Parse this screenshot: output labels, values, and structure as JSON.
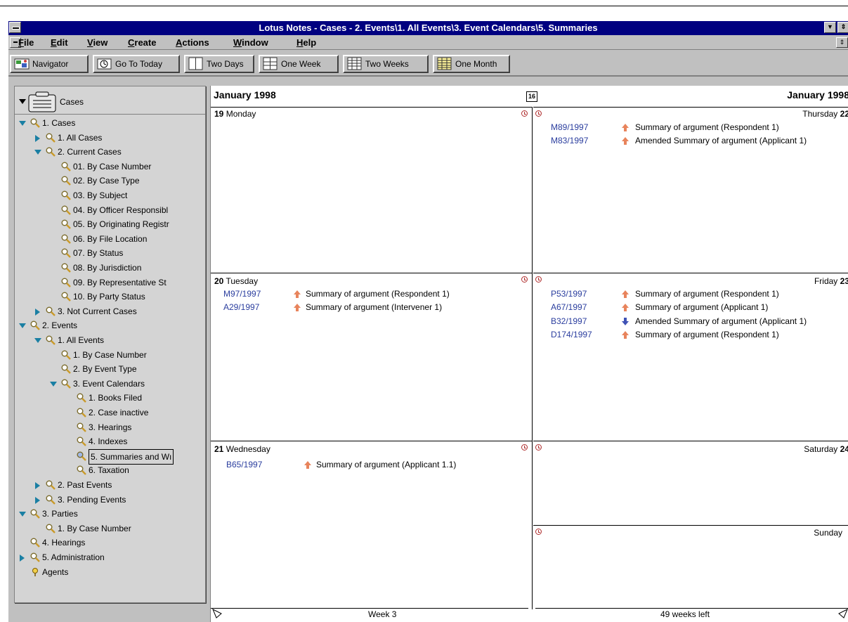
{
  "window": {
    "title": "Lotus Notes - Cases - 2. Events\\1. All Events\\3. Event Calendars\\5. Summaries"
  },
  "menu": [
    {
      "label": "File",
      "u": "F",
      "rest": "ile"
    },
    {
      "label": "Edit",
      "u": "E",
      "rest": "dit"
    },
    {
      "label": "View",
      "u": "V",
      "rest": "iew"
    },
    {
      "label": "Create",
      "u": "C",
      "rest": "reate"
    },
    {
      "label": "Actions",
      "u": "A",
      "rest": "ctions"
    },
    {
      "label": "Window",
      "u": "W",
      "rest": "indow"
    },
    {
      "label": "Help",
      "u": "H",
      "rest": "elp"
    }
  ],
  "toolbar": {
    "navigator": "Navigator",
    "go_to_today": "Go To Today",
    "two_days": "Two Days",
    "one_week": "One Week",
    "two_weeks": "Two Weeks",
    "one_month": "One Month"
  },
  "navigator": {
    "root": "Cases",
    "items": [
      {
        "label": "1. Cases",
        "twistie": "down",
        "level": 0
      },
      {
        "label": "1. All Cases",
        "twistie": "right",
        "level": 1
      },
      {
        "label": "2. Current Cases",
        "twistie": "down",
        "level": 1
      },
      {
        "label": "01. By Case Number",
        "twistie": "",
        "level": 2
      },
      {
        "label": "02. By Case Type",
        "twistie": "",
        "level": 2
      },
      {
        "label": "03. By Subject",
        "twistie": "",
        "level": 2
      },
      {
        "label": "04. By Officer Responsibl",
        "twistie": "",
        "level": 2
      },
      {
        "label": "05. By Originating Registr",
        "twistie": "",
        "level": 2
      },
      {
        "label": "06. By File Location",
        "twistie": "",
        "level": 2
      },
      {
        "label": "07. By Status",
        "twistie": "",
        "level": 2
      },
      {
        "label": "08. By Jurisdiction",
        "twistie": "",
        "level": 2
      },
      {
        "label": "09. By Representative St",
        "twistie": "",
        "level": 2
      },
      {
        "label": "10. By Party Status",
        "twistie": "",
        "level": 2
      },
      {
        "label": "3. Not Current Cases",
        "twistie": "right",
        "level": 1
      },
      {
        "label": "2. Events",
        "twistie": "down",
        "level": 0
      },
      {
        "label": "1. All Events",
        "twistie": "down",
        "level": 1
      },
      {
        "label": "1. By Case Number",
        "twistie": "",
        "level": 2
      },
      {
        "label": "2. By Event Type",
        "twistie": "",
        "level": 2
      },
      {
        "label": "3. Event Calendars",
        "twistie": "down",
        "level": 2
      },
      {
        "label": "1. Books Filed",
        "twistie": "",
        "level": 3
      },
      {
        "label": "2. Case inactive",
        "twistie": "",
        "level": 3
      },
      {
        "label": "3. Hearings",
        "twistie": "",
        "level": 3
      },
      {
        "label": "4. Indexes",
        "twistie": "",
        "level": 3
      },
      {
        "label": "5. Summaries and Wı",
        "twistie": "",
        "level": 3,
        "selected": true
      },
      {
        "label": "6. Taxation",
        "twistie": "",
        "level": 3
      },
      {
        "label": "2. Past Events",
        "twistie": "right",
        "level": 1
      },
      {
        "label": "3. Pending Events",
        "twistie": "right",
        "level": 1
      },
      {
        "label": "3. Parties",
        "twistie": "down",
        "level": 0
      },
      {
        "label": "1. By Case Number",
        "twistie": "",
        "level": 1
      },
      {
        "label": "4. Hearings",
        "twistie": "",
        "level": 0
      },
      {
        "label": "5. Administration",
        "twistie": "right",
        "level": 0
      },
      {
        "label": "Agents",
        "twistie": "",
        "level": 0,
        "icon": "agent"
      }
    ]
  },
  "calendar": {
    "month_left": "January 1998",
    "month_right": "January 1998",
    "today_icon": "16",
    "days": {
      "mon": {
        "num": "19",
        "name": "Monday"
      },
      "tue": {
        "num": "20",
        "name": "Tuesday"
      },
      "wed": {
        "num": "21",
        "name": "Wednesday"
      },
      "thu": {
        "name": "Thursday",
        "num": "22"
      },
      "fri": {
        "name": "Friday",
        "num": "23"
      },
      "sat": {
        "name": "Saturday",
        "num": "24"
      },
      "sun": {
        "name": "Sunday",
        "num": ""
      }
    },
    "events": {
      "tue": [
        {
          "case": "M97/1997",
          "arrow": "up",
          "desc": "Summary of argument (Respondent 1)"
        },
        {
          "case": "A29/1997",
          "arrow": "up",
          "desc": "Summary of argument (Intervener 1)"
        }
      ],
      "wed": [
        {
          "case": "B65/1997",
          "arrow": "up",
          "desc": "Summary of argument (Applicant 1.1)"
        }
      ],
      "thu": [
        {
          "case": "M89/1997",
          "arrow": "up",
          "desc": "Summary of argument (Respondent 1)"
        },
        {
          "case": "M83/1997",
          "arrow": "up",
          "desc": "Amended Summary of argument (Applicant 1)"
        }
      ],
      "fri": [
        {
          "case": "P53/1997",
          "arrow": "up",
          "desc": "Summary of argument (Respondent 1)"
        },
        {
          "case": "A67/1997",
          "arrow": "up",
          "desc": "Summary of argument (Applicant 1)"
        },
        {
          "case": "B32/1997",
          "arrow": "down",
          "desc": "Amended Summary of argument (Applicant 1)"
        },
        {
          "case": "D174/1997",
          "arrow": "up",
          "desc": "Summary of argument (Respondent 1)"
        }
      ]
    },
    "footer_left": "Week 3",
    "footer_right": "49 weeks left"
  },
  "colors": {
    "titlebar": "#000080",
    "case_link": "#2a3d9e",
    "arrow_up": "#e8845c",
    "arrow_down": "#3f52b5"
  }
}
